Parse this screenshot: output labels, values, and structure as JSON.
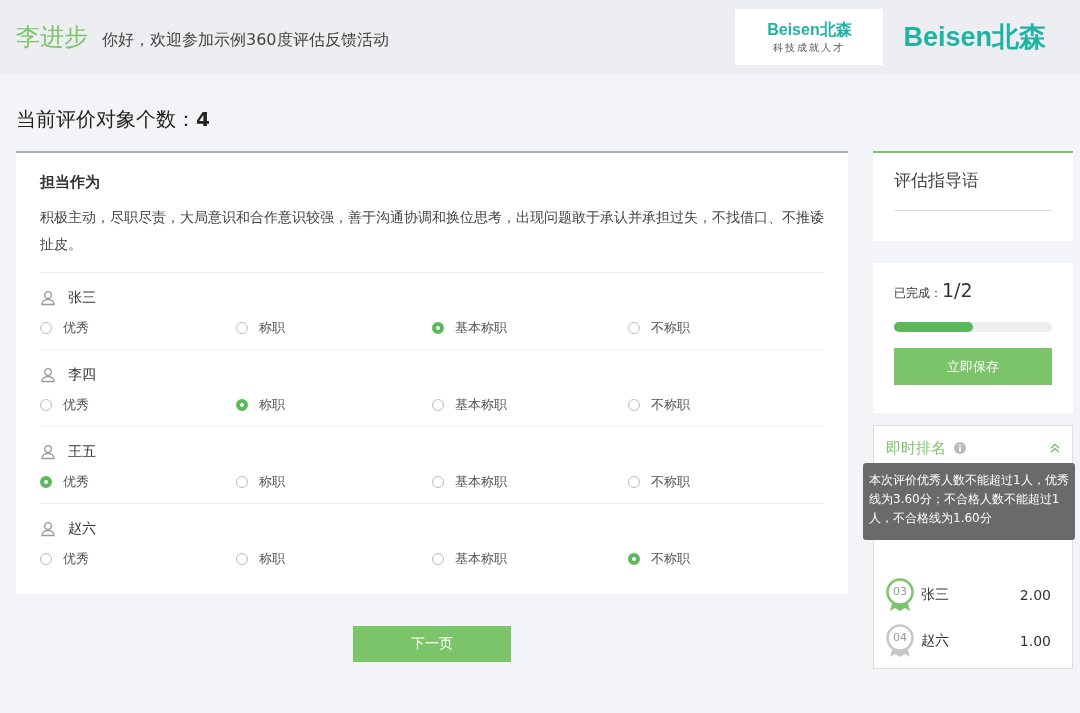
{
  "header": {
    "user_name": "李进步",
    "greeting": "你好，欢迎参加示例360度评估反馈活动",
    "logo_card": {
      "brand": "Beisen北森",
      "slogan": "科技成就人才"
    },
    "logo": {
      "brand": "Beisen北森"
    }
  },
  "count_label": "当前评价对象个数：",
  "count": "4",
  "question": {
    "title": "担当作为",
    "description": "积极主动，尽职尽责，大局意识和合作意识较强，善于沟通协调和换位思考，出现问题敢于承认并承担过失，不找借口、不推诿扯皮。"
  },
  "people": [
    {
      "name": "张三",
      "options": [
        {
          "label": "优秀",
          "selected": false
        },
        {
          "label": "称职",
          "selected": false
        },
        {
          "label": "基本称职",
          "selected": true
        },
        {
          "label": "不称职",
          "selected": false
        }
      ]
    },
    {
      "name": "李四",
      "options": [
        {
          "label": "优秀",
          "selected": false
        },
        {
          "label": "称职",
          "selected": true
        },
        {
          "label": "基本称职",
          "selected": false
        },
        {
          "label": "不称职",
          "selected": false
        }
      ]
    },
    {
      "name": "王五",
      "options": [
        {
          "label": "优秀",
          "selected": true
        },
        {
          "label": "称职",
          "selected": false
        },
        {
          "label": "基本称职",
          "selected": false
        },
        {
          "label": "不称职",
          "selected": false
        }
      ]
    },
    {
      "name": "赵六",
      "options": [
        {
          "label": "优秀",
          "selected": false
        },
        {
          "label": "称职",
          "selected": false
        },
        {
          "label": "基本称职",
          "selected": false
        },
        {
          "label": "不称职",
          "selected": true
        }
      ]
    }
  ],
  "next_button": "下一页",
  "guide": {
    "title": "评估指导语"
  },
  "progress": {
    "label": "已完成：",
    "value": "1/2",
    "level": 0.5,
    "save_button": "立即保存"
  },
  "ranking": {
    "title": "即时排名",
    "expanded": true,
    "tooltip": "本次评价优秀人数不能超过1人，优秀线为3.60分；不合格人数不能超过1人，不合格线为1.60分",
    "rows": [
      {
        "rank": "03",
        "name": "张三",
        "score": "2.00",
        "color": "#7cc46a"
      },
      {
        "rank": "04",
        "name": "赵六",
        "score": "1.00",
        "color": "#c8c8c8"
      }
    ]
  }
}
